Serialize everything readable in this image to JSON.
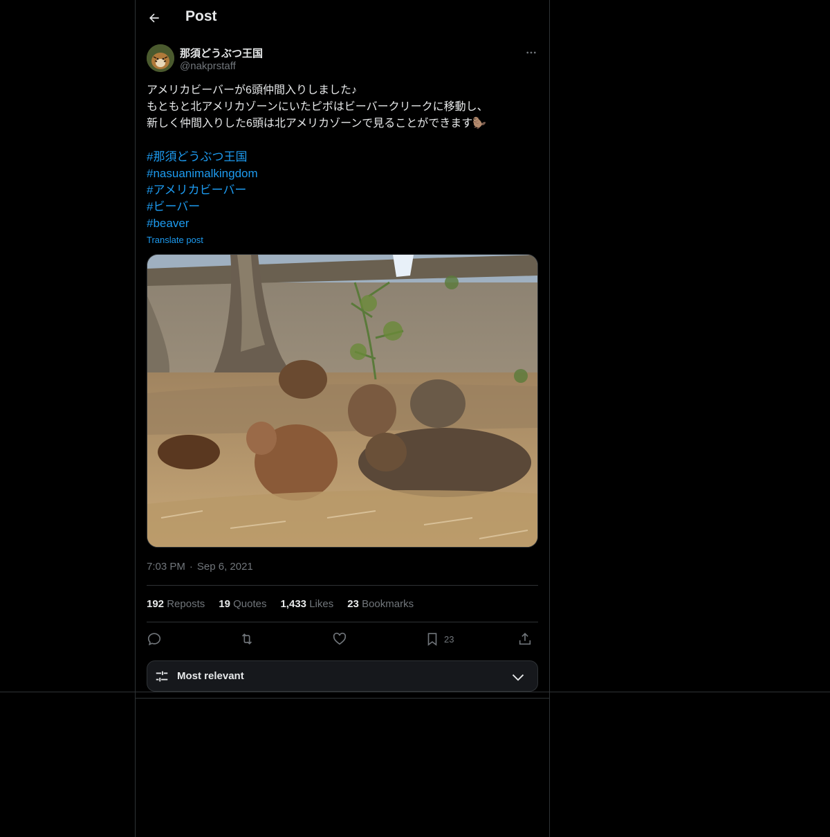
{
  "header": {
    "title": "Post",
    "back_icon": "arrow-left-icon"
  },
  "author": {
    "display_name": "那須どうぶつ王国",
    "handle": "@nakprstaff",
    "more_icon": "more-horizontal-icon"
  },
  "post": {
    "text": "アメリカビーバーが6頭仲間入りしました♪\nもともと北アメリカゾーンにいたピボはビーバークリークに移動し、\n新しく仲間入りした6頭は北アメリカゾーンで見ることができます🦫",
    "hashtags": [
      "#那須どうぶつ王国",
      "#nasuanimalkingdom",
      "#アメリカビーバー",
      "#ビーバー",
      "#beaver"
    ],
    "translate_label": "Translate post",
    "time": "7:03 PM",
    "separator": "·",
    "date": "Sep 6, 2021"
  },
  "stats": {
    "reposts_count": "192",
    "reposts_label": "Reposts",
    "quotes_count": "19",
    "quotes_label": "Quotes",
    "likes_count": "1,433",
    "likes_label": "Likes",
    "bookmarks_count": "23",
    "bookmarks_label": "Bookmarks"
  },
  "actions": {
    "reply_icon": "reply-icon",
    "repost_icon": "repost-icon",
    "like_icon": "heart-icon",
    "bookmark_icon": "bookmark-icon",
    "bookmark_count": "23",
    "share_icon": "share-icon"
  },
  "sort": {
    "label": "Most relevant",
    "icon": "sliders-icon",
    "chevron": "chevron-down-icon"
  },
  "colors": {
    "background": "#000000",
    "text": "#e7e9ea",
    "muted": "#71767b",
    "link": "#1d9bf0",
    "border": "#2f3336"
  }
}
